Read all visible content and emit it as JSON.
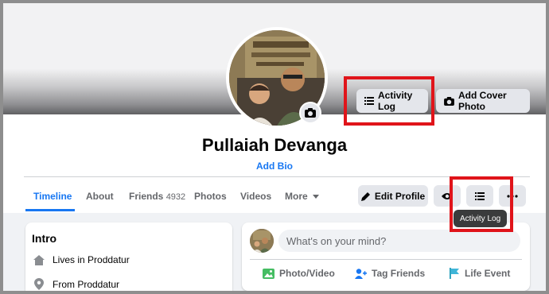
{
  "profile": {
    "name": "Pullaiah Devanga",
    "add_bio": "Add Bio"
  },
  "cover": {
    "activity_log_label": "Activity Log",
    "add_cover_photo_label": "Add Cover Photo"
  },
  "tabs": [
    {
      "label": "Timeline",
      "active": true
    },
    {
      "label": "About"
    },
    {
      "label": "Friends",
      "count": "4932"
    },
    {
      "label": "Photos"
    },
    {
      "label": "Videos"
    },
    {
      "label": "More"
    }
  ],
  "actions": {
    "edit_profile_label": "Edit Profile",
    "tooltip": "Activity Log"
  },
  "intro": {
    "title": "Intro",
    "lives_in": "Lives in Proddatur",
    "from": "From Proddatur"
  },
  "composer": {
    "placeholder": "What's on your mind?",
    "photo_video": "Photo/Video",
    "tag_friends": "Tag Friends",
    "life_event": "Life Event"
  },
  "colors": {
    "accent": "#1877f2",
    "highlight": "#e0141a",
    "button_bg": "#e4e6eb"
  }
}
